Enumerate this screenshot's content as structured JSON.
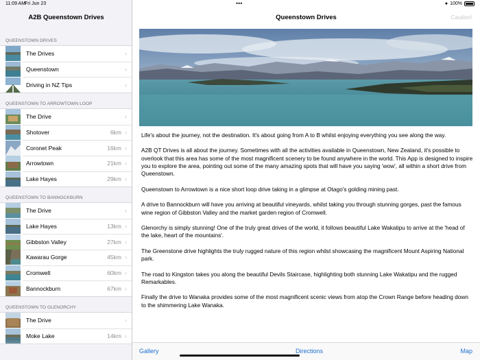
{
  "status_bar": {
    "time": "11:09 AM",
    "date": "Fri Jun 23",
    "battery": "100%"
  },
  "sidebar": {
    "title": "A2B Queenstown Drives",
    "sections": [
      {
        "header": "QUEENSTOWN DRIVES",
        "items": [
          {
            "label": "The Drives",
            "distance": ""
          },
          {
            "label": "Queenstown",
            "distance": ""
          },
          {
            "label": "Driving in NZ Tips",
            "distance": ""
          }
        ]
      },
      {
        "header": "QUEENSTOWN TO ARROWTOWN LOOP",
        "items": [
          {
            "label": "The Drive",
            "distance": ""
          },
          {
            "label": "Shotover",
            "distance": "6km"
          },
          {
            "label": "Coronet Peak",
            "distance": "16km"
          },
          {
            "label": "Arrowtown",
            "distance": "21km"
          },
          {
            "label": "Lake Hayes",
            "distance": "29km"
          }
        ]
      },
      {
        "header": "QUEENSTOWN TO BANNOCKBURN",
        "items": [
          {
            "label": "The Drive",
            "distance": ""
          },
          {
            "label": "Lake Hayes",
            "distance": "13km"
          },
          {
            "label": "Gibbston Valley",
            "distance": "27km"
          },
          {
            "label": "Kawarau Gorge",
            "distance": "45km"
          },
          {
            "label": "Cromwell",
            "distance": "60km"
          },
          {
            "label": "Bannockburn",
            "distance": "67km"
          }
        ]
      },
      {
        "header": "QUEENSTOWN TO GLENORCHY",
        "items": [
          {
            "label": "The Drive",
            "distance": ""
          },
          {
            "label": "Moke Lake",
            "distance": "14km"
          }
        ]
      }
    ]
  },
  "detail": {
    "title": "Queenstown Drives",
    "caution_label": "Caution!",
    "paragraphs": [
      "Life's about the journey, not the destination.  It's about going from A to B whilst enjoying everything you see along the way.",
      "A2B QT Drives is all about the journey.  Sometimes with all the activities available in Queenstown, New Zealand, it's possible to overlook that this area has some of the most magnificent scenery to be found anywhere in the world.  This App is designed to inspire you to explore the area, pointing out some of the many amazing spots that will have you saying 'wow', all within a short drive from Queenstown.",
      "Queenstown to Arrowtown is a nice short loop drive taking in a glimpse at Otago's golding mining past.",
      "A drive to Bannockburn will have you arriving at beautiful vineyards, whilst taking you through stunning gorges, past the famous wine region of Gibbston Valley and the market garden region of Cromwell.",
      "Glenorchy is simply stunning!  One of the truly great drives of the world, it follows beautiful Lake Wakatipu to arrive at the 'head of the lake, heart of the mountains'.",
      "The Greenstone drive highlights the truly rugged nature of this region whilst showcasing the magnificent Mount Aspiring National park.",
      "The road to Kingston takes you along the beautiful Devils Staircase, highlighting both stunning Lake Wakatipu and the rugged Remarkables.",
      "Finally the drive to Wanaka provides some of the most magnificent scenic views from atop the Crown Range before heading down to the shimmering Lake Wanaka."
    ]
  },
  "tabbar": {
    "gallery": "Gallery",
    "directions": "Directions",
    "map": "Map"
  },
  "colors": {
    "accent": "#1e6fd0",
    "sidebar_bg": "#f2f2f7",
    "lake": "#3f8a9a"
  }
}
